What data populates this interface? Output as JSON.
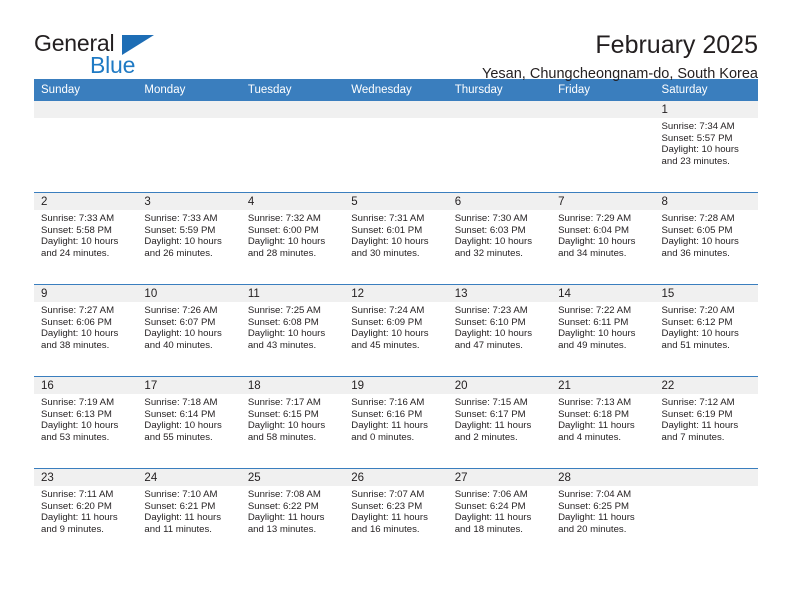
{
  "brand": {
    "name_part1": "General",
    "name_part2": "Blue",
    "accent_color": "#1f7ac4"
  },
  "header": {
    "title": "February 2025",
    "subtitle": "Yesan, Chungcheongnam-do, South Korea",
    "header_bg_color": "#3a7ebe"
  },
  "calendar": {
    "weekday_headers": [
      "Sunday",
      "Monday",
      "Tuesday",
      "Wednesday",
      "Thursday",
      "Friday",
      "Saturday"
    ],
    "weeks": [
      [
        {
          "day": "",
          "sunrise": "",
          "sunset": "",
          "daylight": "",
          "empty": true
        },
        {
          "day": "",
          "sunrise": "",
          "sunset": "",
          "daylight": "",
          "empty": true
        },
        {
          "day": "",
          "sunrise": "",
          "sunset": "",
          "daylight": "",
          "empty": true
        },
        {
          "day": "",
          "sunrise": "",
          "sunset": "",
          "daylight": "",
          "empty": true
        },
        {
          "day": "",
          "sunrise": "",
          "sunset": "",
          "daylight": "",
          "empty": true
        },
        {
          "day": "",
          "sunrise": "",
          "sunset": "",
          "daylight": "",
          "empty": true
        },
        {
          "day": "1",
          "sunrise": "Sunrise: 7:34 AM",
          "sunset": "Sunset: 5:57 PM",
          "daylight": "Daylight: 10 hours and 23 minutes.",
          "empty": false
        }
      ],
      [
        {
          "day": "2",
          "sunrise": "Sunrise: 7:33 AM",
          "sunset": "Sunset: 5:58 PM",
          "daylight": "Daylight: 10 hours and 24 minutes.",
          "empty": false
        },
        {
          "day": "3",
          "sunrise": "Sunrise: 7:33 AM",
          "sunset": "Sunset: 5:59 PM",
          "daylight": "Daylight: 10 hours and 26 minutes.",
          "empty": false
        },
        {
          "day": "4",
          "sunrise": "Sunrise: 7:32 AM",
          "sunset": "Sunset: 6:00 PM",
          "daylight": "Daylight: 10 hours and 28 minutes.",
          "empty": false
        },
        {
          "day": "5",
          "sunrise": "Sunrise: 7:31 AM",
          "sunset": "Sunset: 6:01 PM",
          "daylight": "Daylight: 10 hours and 30 minutes.",
          "empty": false
        },
        {
          "day": "6",
          "sunrise": "Sunrise: 7:30 AM",
          "sunset": "Sunset: 6:03 PM",
          "daylight": "Daylight: 10 hours and 32 minutes.",
          "empty": false
        },
        {
          "day": "7",
          "sunrise": "Sunrise: 7:29 AM",
          "sunset": "Sunset: 6:04 PM",
          "daylight": "Daylight: 10 hours and 34 minutes.",
          "empty": false
        },
        {
          "day": "8",
          "sunrise": "Sunrise: 7:28 AM",
          "sunset": "Sunset: 6:05 PM",
          "daylight": "Daylight: 10 hours and 36 minutes.",
          "empty": false
        }
      ],
      [
        {
          "day": "9",
          "sunrise": "Sunrise: 7:27 AM",
          "sunset": "Sunset: 6:06 PM",
          "daylight": "Daylight: 10 hours and 38 minutes.",
          "empty": false
        },
        {
          "day": "10",
          "sunrise": "Sunrise: 7:26 AM",
          "sunset": "Sunset: 6:07 PM",
          "daylight": "Daylight: 10 hours and 40 minutes.",
          "empty": false
        },
        {
          "day": "11",
          "sunrise": "Sunrise: 7:25 AM",
          "sunset": "Sunset: 6:08 PM",
          "daylight": "Daylight: 10 hours and 43 minutes.",
          "empty": false
        },
        {
          "day": "12",
          "sunrise": "Sunrise: 7:24 AM",
          "sunset": "Sunset: 6:09 PM",
          "daylight": "Daylight: 10 hours and 45 minutes.",
          "empty": false
        },
        {
          "day": "13",
          "sunrise": "Sunrise: 7:23 AM",
          "sunset": "Sunset: 6:10 PM",
          "daylight": "Daylight: 10 hours and 47 minutes.",
          "empty": false
        },
        {
          "day": "14",
          "sunrise": "Sunrise: 7:22 AM",
          "sunset": "Sunset: 6:11 PM",
          "daylight": "Daylight: 10 hours and 49 minutes.",
          "empty": false
        },
        {
          "day": "15",
          "sunrise": "Sunrise: 7:20 AM",
          "sunset": "Sunset: 6:12 PM",
          "daylight": "Daylight: 10 hours and 51 minutes.",
          "empty": false
        }
      ],
      [
        {
          "day": "16",
          "sunrise": "Sunrise: 7:19 AM",
          "sunset": "Sunset: 6:13 PM",
          "daylight": "Daylight: 10 hours and 53 minutes.",
          "empty": false
        },
        {
          "day": "17",
          "sunrise": "Sunrise: 7:18 AM",
          "sunset": "Sunset: 6:14 PM",
          "daylight": "Daylight: 10 hours and 55 minutes.",
          "empty": false
        },
        {
          "day": "18",
          "sunrise": "Sunrise: 7:17 AM",
          "sunset": "Sunset: 6:15 PM",
          "daylight": "Daylight: 10 hours and 58 minutes.",
          "empty": false
        },
        {
          "day": "19",
          "sunrise": "Sunrise: 7:16 AM",
          "sunset": "Sunset: 6:16 PM",
          "daylight": "Daylight: 11 hours and 0 minutes.",
          "empty": false
        },
        {
          "day": "20",
          "sunrise": "Sunrise: 7:15 AM",
          "sunset": "Sunset: 6:17 PM",
          "daylight": "Daylight: 11 hours and 2 minutes.",
          "empty": false
        },
        {
          "day": "21",
          "sunrise": "Sunrise: 7:13 AM",
          "sunset": "Sunset: 6:18 PM",
          "daylight": "Daylight: 11 hours and 4 minutes.",
          "empty": false
        },
        {
          "day": "22",
          "sunrise": "Sunrise: 7:12 AM",
          "sunset": "Sunset: 6:19 PM",
          "daylight": "Daylight: 11 hours and 7 minutes.",
          "empty": false
        }
      ],
      [
        {
          "day": "23",
          "sunrise": "Sunrise: 7:11 AM",
          "sunset": "Sunset: 6:20 PM",
          "daylight": "Daylight: 11 hours and 9 minutes.",
          "empty": false
        },
        {
          "day": "24",
          "sunrise": "Sunrise: 7:10 AM",
          "sunset": "Sunset: 6:21 PM",
          "daylight": "Daylight: 11 hours and 11 minutes.",
          "empty": false
        },
        {
          "day": "25",
          "sunrise": "Sunrise: 7:08 AM",
          "sunset": "Sunset: 6:22 PM",
          "daylight": "Daylight: 11 hours and 13 minutes.",
          "empty": false
        },
        {
          "day": "26",
          "sunrise": "Sunrise: 7:07 AM",
          "sunset": "Sunset: 6:23 PM",
          "daylight": "Daylight: 11 hours and 16 minutes.",
          "empty": false
        },
        {
          "day": "27",
          "sunrise": "Sunrise: 7:06 AM",
          "sunset": "Sunset: 6:24 PM",
          "daylight": "Daylight: 11 hours and 18 minutes.",
          "empty": false
        },
        {
          "day": "28",
          "sunrise": "Sunrise: 7:04 AM",
          "sunset": "Sunset: 6:25 PM",
          "daylight": "Daylight: 11 hours and 20 minutes.",
          "empty": false
        },
        {
          "day": "",
          "sunrise": "",
          "sunset": "",
          "daylight": "",
          "empty": true
        }
      ]
    ]
  }
}
